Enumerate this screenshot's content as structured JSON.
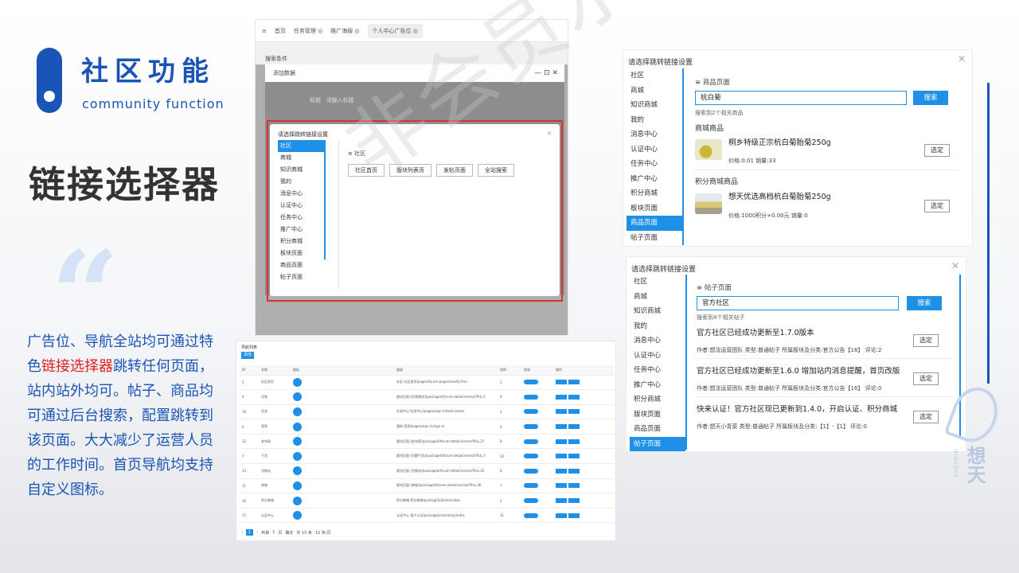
{
  "header": {
    "title_cn": "社区功能",
    "title_en": "community function",
    "main_title": "链接选择器",
    "quote_mark": "“"
  },
  "description": {
    "part1": "广告位、导航全站均可通过特色",
    "highlight": "链接选择器",
    "part2": "跳转任何页面，站内站外均可。帖子、商品均可通过后台搜索，配置跳转到该页面。大大减少了运营人员的工作时间。首页导航均支持自定义图标。"
  },
  "watermark": "非会员水印",
  "brand": {
    "name_cn": "想天",
    "name_en": "HINKSKY"
  },
  "shot1": {
    "tabs": [
      "首页",
      "任务管理 ◎",
      "推广海报 ◎",
      "个人中心广告位 ◎"
    ],
    "search_label": "搜索条件",
    "add_dialog_title": "添加数据",
    "field_label": "标题",
    "field_placeholder": "请输入标题",
    "inner_title": "请选择跳转链接设置",
    "menu": [
      "社区",
      "商城",
      "知识商城",
      "我的",
      "消息中心",
      "认证中心",
      "任务中心",
      "推广中心",
      "积分商城",
      "板块页面",
      "商品页面",
      "帖子页面"
    ],
    "section": "社区",
    "buttons": [
      "社区首页",
      "版块列表页",
      "发帖页面",
      "全站搜索"
    ]
  },
  "shot2": {
    "title": "导航列表",
    "add_label": "添加",
    "headers": [
      "ID",
      "名称",
      "图标",
      "链接",
      "排序",
      "状态",
      "操作"
    ],
    "rows": [
      [
        "5",
        "社区首页",
        "社区-社区首页/pages/forum-page/classify-find",
        "1"
      ],
      [
        "4",
        "问答",
        "版块页面-[问答版块]/package4/forum-detail/normal?fid=5",
        "9"
      ],
      [
        "10",
        "任务",
        "任务中心-任务中心/pages/sign-in/task-center",
        "3"
      ],
      [
        "6",
        "签到",
        "我的-签到/pages/sign-in/sign-in",
        "4"
      ],
      [
        "12",
        "发布帮",
        "版块页面-[发布帮]/package4/forum-detail/normal?fid=37",
        "8"
      ],
      [
        "7",
        "干货",
        "版块页面-[问题干货]/package4/forum-detail/normal?fid=7",
        "10"
      ],
      [
        "13",
        "兑换站",
        "版块页面-[兑换站]/package4/forum-detail/normal?fid=35",
        "6"
      ],
      [
        "11",
        "商城",
        "版块页面-[商城]/package4/forum-detail/normal?fid=36",
        "7"
      ],
      [
        "16",
        "积分商城",
        "积分商城-积分商城/package2/points/index",
        "2"
      ],
      [
        "17",
        "认证中心",
        "认证中心-用户认证/package2/certainty/index",
        "11"
      ]
    ],
    "footer": [
      "1",
      "到第",
      "1",
      "页",
      "确定",
      "共 15 条",
      "10 条/页"
    ]
  },
  "shot3": {
    "title": "请选择跳转链接设置",
    "menu": [
      "社区",
      "商城",
      "知识商城",
      "我的",
      "消息中心",
      "认证中心",
      "任务中心",
      "推广中心",
      "积分商城",
      "板块页面",
      "商品页面",
      "帖子页面"
    ],
    "active_index": 10,
    "section": "商品页面",
    "query": "杭白菊",
    "search_label": "搜索",
    "hint": "搜索到2个相关商品",
    "group1": "商城商品",
    "item1_name": "桐乡特级正宗杭白菊胎菊250g",
    "item1_meta": "价格:0.01   销量:33",
    "group2": "积分商城商品",
    "item2_name": "想天优选高档杭白菊胎菊250g",
    "item2_meta": "价格:1000积分+0.00元   销量:0",
    "pick_label": "选定"
  },
  "shot4": {
    "title": "请选择跳转链接设置",
    "menu": [
      "社区",
      "商城",
      "知识商城",
      "我的",
      "消息中心",
      "认证中心",
      "任务中心",
      "推广中心",
      "积分商城",
      "版块页面",
      "商品页面",
      "帖子页面"
    ],
    "active_index": 11,
    "section": "帖子页面",
    "query": "官方社区",
    "search_label": "搜索",
    "hint": "搜索到4个相关帖子",
    "posts": [
      {
        "title": "官方社区已经成功更新至1.7.0版本",
        "meta": "作者:想法运营团队   类型:普通帖子   所属板块及分类:官方公告【16】   评论:2"
      },
      {
        "title": "官方社区已经成功更新至1.6.0 增加站内消息提醒，首页改版",
        "meta": "作者:想法运营团队   类型:普通帖子   所属板块及分类:官方公告【16】   评论:0"
      },
      {
        "title": "快来认证！官方社区现已更新到1.4.0，开启认证、积分商城",
        "meta": "作者:想天小青菜   类型:普通帖子   所属板块及分类:【1】-【1】   评论:0"
      }
    ],
    "pick_label": "选定"
  },
  "colors": {
    "brand": "#1a55b5",
    "accent": "#1e90e8",
    "highlight": "#e02020",
    "redbox": "#d9322f"
  }
}
